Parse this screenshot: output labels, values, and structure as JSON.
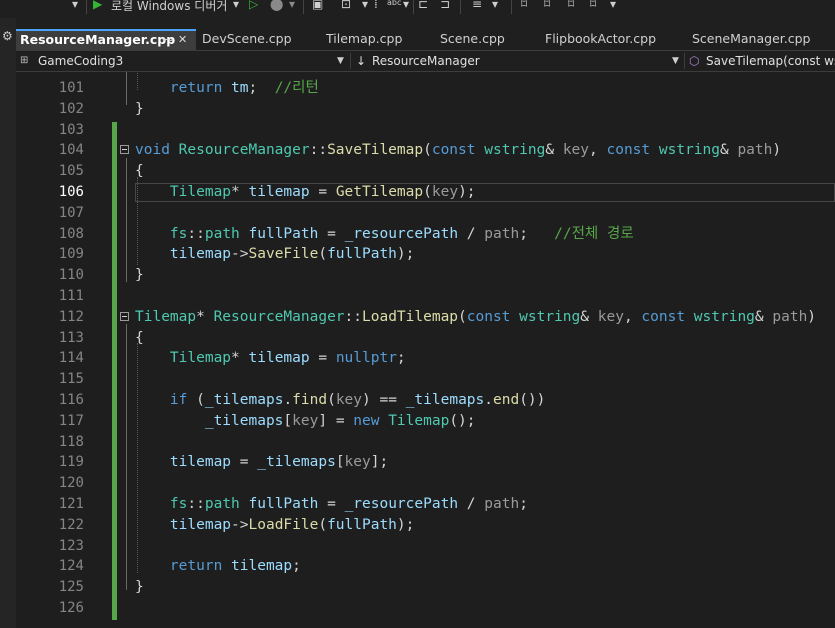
{
  "toolbar": {
    "run_label": "로컬 Windows 디버거",
    "dropdown_glyph": "▾"
  },
  "tabs": [
    {
      "label": "ResourceManager.cpp",
      "pin": "⊷",
      "close": "✕",
      "active": true
    },
    {
      "label": "DevScene.cpp"
    },
    {
      "label": "Tilemap.cpp"
    },
    {
      "label": "Scene.cpp"
    },
    {
      "label": "FlipbookActor.cpp"
    },
    {
      "label": "SceneManager.cpp"
    }
  ],
  "navbar": {
    "project": "GameCoding3",
    "scope": "ResourceManager",
    "member": "SaveTilemap(const wstri"
  },
  "editor": {
    "current_line": 106,
    "lines": [
      {
        "n": "101",
        "t": [
          [
            "    return ",
            "kw"
          ],
          [
            "tm",
            "id"
          ],
          [
            "; ",
            ""
          ],
          [
            " //리턴",
            "cm"
          ]
        ]
      },
      {
        "n": "102",
        "t": [
          [
            "}",
            ""
          ]
        ]
      },
      {
        "n": "103",
        "t": []
      },
      {
        "n": "104",
        "fold": true,
        "t": [
          [
            "void ",
            "kw"
          ],
          [
            "ResourceManager",
            "ty"
          ],
          [
            "::",
            ""
          ],
          [
            "SaveTilemap",
            "fn"
          ],
          [
            "(",
            ""
          ],
          [
            "const ",
            "kw"
          ],
          [
            "wstring",
            "ty"
          ],
          [
            "& ",
            ""
          ],
          [
            "key",
            "pa"
          ],
          [
            ", ",
            ""
          ],
          [
            "const ",
            "kw"
          ],
          [
            "wstring",
            "ty"
          ],
          [
            "& ",
            ""
          ],
          [
            "path",
            "pa"
          ],
          [
            ")",
            ""
          ]
        ]
      },
      {
        "n": "105",
        "t": [
          [
            "{",
            ""
          ]
        ]
      },
      {
        "n": "106",
        "t": [
          [
            "    ",
            ""
          ],
          [
            "Tilemap",
            "ty"
          ],
          [
            "* ",
            ""
          ],
          [
            "tilemap",
            "id"
          ],
          [
            " = ",
            ""
          ],
          [
            "GetTilemap",
            "fn"
          ],
          [
            "(",
            ""
          ],
          [
            "key",
            "pa"
          ],
          [
            ");",
            ""
          ]
        ]
      },
      {
        "n": "107",
        "t": []
      },
      {
        "n": "108",
        "t": [
          [
            "    ",
            ""
          ],
          [
            "fs",
            "ty"
          ],
          [
            "::",
            ""
          ],
          [
            "path",
            "ty"
          ],
          [
            " ",
            ""
          ],
          [
            "fullPath",
            "id"
          ],
          [
            " = ",
            ""
          ],
          [
            "_resourcePath",
            "id"
          ],
          [
            " / ",
            ""
          ],
          [
            "path",
            "pa"
          ],
          [
            ";   ",
            ""
          ],
          [
            "//전체 경로",
            "cm"
          ]
        ]
      },
      {
        "n": "109",
        "t": [
          [
            "    ",
            ""
          ],
          [
            "tilemap",
            "id"
          ],
          [
            "->",
            ""
          ],
          [
            "SaveFile",
            "fn"
          ],
          [
            "(",
            ""
          ],
          [
            "fullPath",
            "id"
          ],
          [
            ");",
            ""
          ]
        ]
      },
      {
        "n": "110",
        "t": [
          [
            "}",
            ""
          ]
        ]
      },
      {
        "n": "111",
        "t": []
      },
      {
        "n": "112",
        "fold": true,
        "t": [
          [
            "Tilemap",
            "ty"
          ],
          [
            "* ",
            ""
          ],
          [
            "ResourceManager",
            "ty"
          ],
          [
            "::",
            ""
          ],
          [
            "LoadTilemap",
            "fn"
          ],
          [
            "(",
            ""
          ],
          [
            "const ",
            "kw"
          ],
          [
            "wstring",
            "ty"
          ],
          [
            "& ",
            ""
          ],
          [
            "key",
            "pa"
          ],
          [
            ", ",
            ""
          ],
          [
            "const ",
            "kw"
          ],
          [
            "wstring",
            "ty"
          ],
          [
            "& ",
            ""
          ],
          [
            "path",
            "pa"
          ],
          [
            ")",
            ""
          ]
        ]
      },
      {
        "n": "113",
        "t": [
          [
            "{",
            ""
          ]
        ]
      },
      {
        "n": "114",
        "t": [
          [
            "    ",
            ""
          ],
          [
            "Tilemap",
            "ty"
          ],
          [
            "* ",
            ""
          ],
          [
            "tilemap",
            "id"
          ],
          [
            " = ",
            ""
          ],
          [
            "nullptr",
            "kw"
          ],
          [
            ";",
            ""
          ]
        ]
      },
      {
        "n": "115",
        "t": []
      },
      {
        "n": "116",
        "t": [
          [
            "    ",
            ""
          ],
          [
            "if",
            "kw"
          ],
          [
            " (",
            ""
          ],
          [
            "_tilemaps",
            "id"
          ],
          [
            ".",
            ""
          ],
          [
            "find",
            "fn"
          ],
          [
            "(",
            ""
          ],
          [
            "key",
            "pa"
          ],
          [
            ") == ",
            ""
          ],
          [
            "_tilemaps",
            "id"
          ],
          [
            ".",
            ""
          ],
          [
            "end",
            "fn"
          ],
          [
            "())",
            ""
          ]
        ]
      },
      {
        "n": "117",
        "t": [
          [
            "        ",
            ""
          ],
          [
            "_tilemaps",
            "id"
          ],
          [
            "[",
            ""
          ],
          [
            "key",
            "pa"
          ],
          [
            "] = ",
            ""
          ],
          [
            "new ",
            "kw"
          ],
          [
            "Tilemap",
            "ty"
          ],
          [
            "();",
            ""
          ]
        ]
      },
      {
        "n": "118",
        "t": []
      },
      {
        "n": "119",
        "t": [
          [
            "    ",
            ""
          ],
          [
            "tilemap",
            "id"
          ],
          [
            " = ",
            ""
          ],
          [
            "_tilemaps",
            "id"
          ],
          [
            "[",
            ""
          ],
          [
            "key",
            "pa"
          ],
          [
            "];",
            ""
          ]
        ]
      },
      {
        "n": "120",
        "t": []
      },
      {
        "n": "121",
        "t": [
          [
            "    ",
            ""
          ],
          [
            "fs",
            "ty"
          ],
          [
            "::",
            ""
          ],
          [
            "path",
            "ty"
          ],
          [
            " ",
            ""
          ],
          [
            "fullPath",
            "id"
          ],
          [
            " = ",
            ""
          ],
          [
            "_resourcePath",
            "id"
          ],
          [
            " / ",
            ""
          ],
          [
            "path",
            "pa"
          ],
          [
            ";",
            ""
          ]
        ]
      },
      {
        "n": "122",
        "t": [
          [
            "    ",
            ""
          ],
          [
            "tilemap",
            "id"
          ],
          [
            "->",
            ""
          ],
          [
            "LoadFile",
            "fn"
          ],
          [
            "(",
            ""
          ],
          [
            "fullPath",
            "id"
          ],
          [
            ");",
            ""
          ]
        ]
      },
      {
        "n": "123",
        "t": []
      },
      {
        "n": "124",
        "t": [
          [
            "    ",
            ""
          ],
          [
            "return ",
            "kw"
          ],
          [
            "tilemap",
            "id"
          ],
          [
            ";",
            ""
          ]
        ]
      },
      {
        "n": "125",
        "t": [
          [
            "}",
            ""
          ]
        ]
      },
      {
        "n": "126",
        "t": []
      }
    ]
  }
}
